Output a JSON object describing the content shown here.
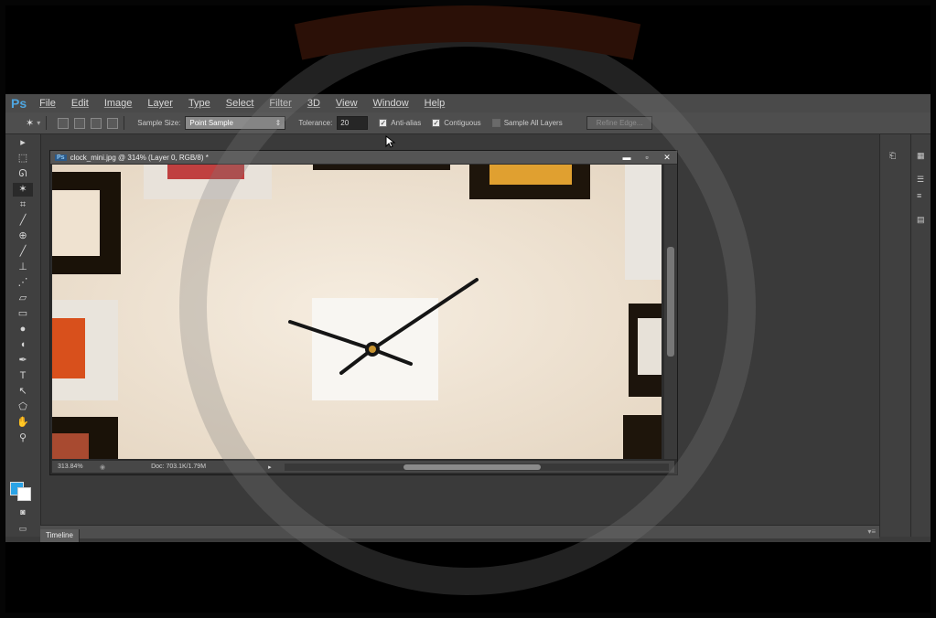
{
  "app": {
    "logo": "Ps",
    "menu": [
      "File",
      "Edit",
      "Image",
      "Layer",
      "Type",
      "Select",
      "Filter",
      "3D",
      "View",
      "Window",
      "Help"
    ]
  },
  "options": {
    "sample_size_label": "Sample Size:",
    "sample_size_value": "Point Sample",
    "tolerance_label": "Tolerance:",
    "tolerance_value": "20",
    "anti_alias_label": "Anti-alias",
    "anti_alias_checked": true,
    "contiguous_label": "Contiguous",
    "contiguous_checked": true,
    "sample_all_layers_label": "Sample All Layers",
    "sample_all_layers_checked": false,
    "refine_edge_label": "Refine Edge..."
  },
  "tools": [
    "move-tool-icon",
    "marquee-tool-icon",
    "lasso-tool-icon",
    "magic-wand-tool-icon",
    "crop-tool-icon",
    "eyedropper-tool-icon",
    "healing-brush-tool-icon",
    "brush-tool-icon",
    "clone-stamp-tool-icon",
    "history-brush-tool-icon",
    "eraser-tool-icon",
    "gradient-tool-icon",
    "blur-tool-icon",
    "dodge-tool-icon",
    "pen-tool-icon",
    "type-tool-icon",
    "path-selection-tool-icon",
    "shape-tool-icon",
    "hand-tool-icon",
    "zoom-tool-icon"
  ],
  "tool_glyphs": [
    "▸",
    "⬚",
    "ᘏ",
    "✶",
    "⌗",
    "╱",
    "⊕",
    "╱",
    "⊥",
    "⋰",
    "▱",
    "▭",
    "●",
    "◖",
    "✒",
    "T",
    "↖",
    "⬠",
    "✋",
    "⚲"
  ],
  "document": {
    "title": "clock_mini.jpg @ 314% (Layer 0, RGB/8) *",
    "zoom": "313.84%",
    "doc_info": "Doc: 703.1K/1.79M"
  },
  "timeline": {
    "tab_label": "Timeline"
  },
  "colors": {
    "foreground": "#2aa3e6",
    "background": "#ffffff",
    "accent": "#4fa6e0"
  }
}
